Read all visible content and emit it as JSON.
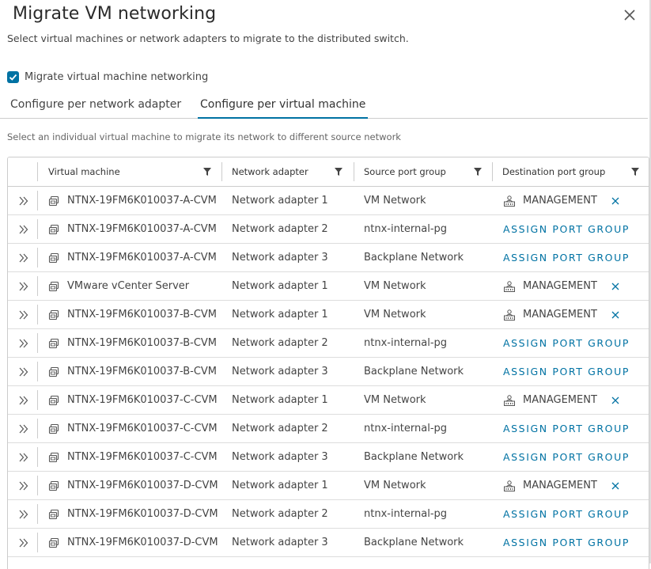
{
  "dialog": {
    "title": "Migrate VM networking",
    "subtitle": "Select virtual machines or network adapters to migrate to the distributed switch.",
    "checkbox_label": "Migrate virtual machine networking",
    "checkbox_checked": true,
    "tabs": [
      {
        "label": "Configure per network adapter",
        "active": false
      },
      {
        "label": "Configure per virtual machine",
        "active": true
      }
    ],
    "hint": "Select an individual virtual machine to migrate its network to different source network"
  },
  "colors": {
    "accent": "#0072a3",
    "border": "#cccccc",
    "text": "#444444"
  },
  "grid": {
    "columns": [
      "Virtual machine",
      "Network adapter",
      "Source port group",
      "Destination port group"
    ],
    "assign_label": "ASSIGN PORT GROUP",
    "rows": [
      {
        "vm": "NTNX-19FM6K010037-A-CVM",
        "adapter": "Network adapter 1",
        "source": "VM Network",
        "dest": "MANAGEMENT"
      },
      {
        "vm": "NTNX-19FM6K010037-A-CVM",
        "adapter": "Network adapter 2",
        "source": "ntnx-internal-pg",
        "dest": null
      },
      {
        "vm": "NTNX-19FM6K010037-A-CVM",
        "adapter": "Network adapter 3",
        "source": "Backplane Network",
        "dest": null
      },
      {
        "vm": "VMware vCenter Server",
        "adapter": "Network adapter 1",
        "source": "VM Network",
        "dest": "MANAGEMENT"
      },
      {
        "vm": "NTNX-19FM6K010037-B-CVM",
        "adapter": "Network adapter 1",
        "source": "VM Network",
        "dest": "MANAGEMENT"
      },
      {
        "vm": "NTNX-19FM6K010037-B-CVM",
        "adapter": "Network adapter 2",
        "source": "ntnx-internal-pg",
        "dest": null
      },
      {
        "vm": "NTNX-19FM6K010037-B-CVM",
        "adapter": "Network adapter 3",
        "source": "Backplane Network",
        "dest": null
      },
      {
        "vm": "NTNX-19FM6K010037-C-CVM",
        "adapter": "Network adapter 1",
        "source": "VM Network",
        "dest": "MANAGEMENT"
      },
      {
        "vm": "NTNX-19FM6K010037-C-CVM",
        "adapter": "Network adapter 2",
        "source": "ntnx-internal-pg",
        "dest": null
      },
      {
        "vm": "NTNX-19FM6K010037-C-CVM",
        "adapter": "Network adapter 3",
        "source": "Backplane Network",
        "dest": null
      },
      {
        "vm": "NTNX-19FM6K010037-D-CVM",
        "adapter": "Network adapter 1",
        "source": "VM Network",
        "dest": "MANAGEMENT"
      },
      {
        "vm": "NTNX-19FM6K010037-D-CVM",
        "adapter": "Network adapter 2",
        "source": "ntnx-internal-pg",
        "dest": null
      },
      {
        "vm": "NTNX-19FM6K010037-D-CVM",
        "adapter": "Network adapter 3",
        "source": "Backplane Network",
        "dest": null
      }
    ]
  }
}
